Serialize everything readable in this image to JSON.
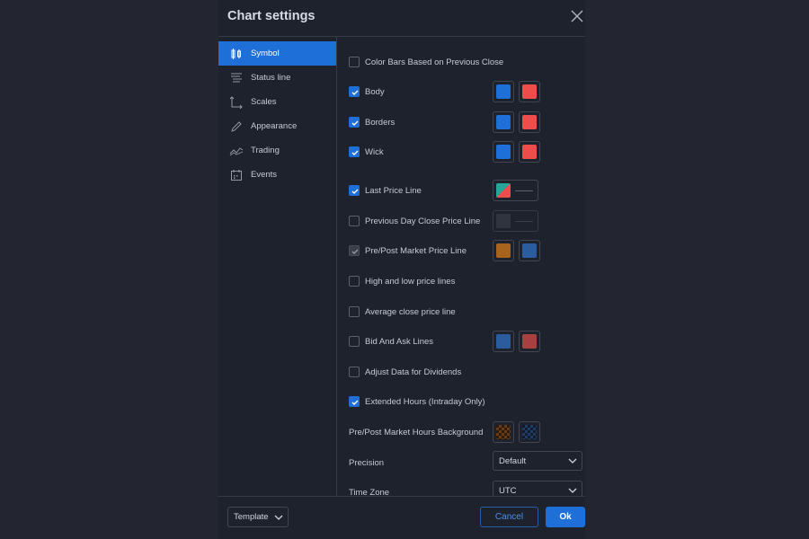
{
  "dialog": {
    "title": "Chart settings"
  },
  "sidebar": {
    "items": [
      {
        "label": "Symbol",
        "icon": "candles-icon",
        "active": true
      },
      {
        "label": "Status line",
        "icon": "status-line-icon",
        "active": false
      },
      {
        "label": "Scales",
        "icon": "scales-icon",
        "active": false
      },
      {
        "label": "Appearance",
        "icon": "pencil-icon",
        "active": false
      },
      {
        "label": "Trading",
        "icon": "trading-icon",
        "active": false
      },
      {
        "label": "Events",
        "icon": "calendar-icon",
        "active": false
      }
    ]
  },
  "symbol": {
    "color_bars": {
      "label": "Color Bars Based on Previous Close",
      "checked": false
    },
    "body": {
      "label": "Body",
      "checked": true,
      "colors": [
        "#1f6fd8",
        "#ef4c4c"
      ]
    },
    "borders": {
      "label": "Borders",
      "checked": true,
      "colors": [
        "#1f6fd8",
        "#ef4c4c"
      ]
    },
    "wick": {
      "label": "Wick",
      "checked": true,
      "colors": [
        "#1f6fd8",
        "#ef4c4c"
      ]
    },
    "last_price_line": {
      "label": "Last Price Line",
      "checked": true,
      "colors": [
        "#26a69a",
        "#ef4c4c"
      ]
    },
    "prev_day_close": {
      "label": "Previous Day Close Price Line",
      "checked": false,
      "colors": [
        "#3a3d46"
      ]
    },
    "pre_post_market": {
      "label": "Pre/Post Market Price Line",
      "checked": true,
      "colors": [
        "#a8641c",
        "#2a5c9e"
      ]
    },
    "high_low": {
      "label": "High and low price lines",
      "checked": false
    },
    "avg_close": {
      "label": "Average close price line",
      "checked": false
    },
    "bid_ask": {
      "label": "Bid And Ask Lines",
      "checked": false,
      "colors": [
        "#2a5c9e",
        "#a84040"
      ]
    },
    "adjust_dividends": {
      "label": "Adjust Data for Dividends",
      "checked": false
    },
    "extended_hours": {
      "label": "Extended Hours (Intraday Only)",
      "checked": true
    },
    "pre_post_bg": {
      "label": "Pre/Post Market Hours Background",
      "colors": [
        "#6b3a10",
        "#1d3c6a"
      ]
    },
    "precision": {
      "label": "Precision",
      "value": "Default"
    },
    "time_zone": {
      "label": "Time Zone",
      "value": "UTC"
    }
  },
  "footer": {
    "template_label": "Template",
    "cancel_label": "Cancel",
    "ok_label": "Ok"
  }
}
